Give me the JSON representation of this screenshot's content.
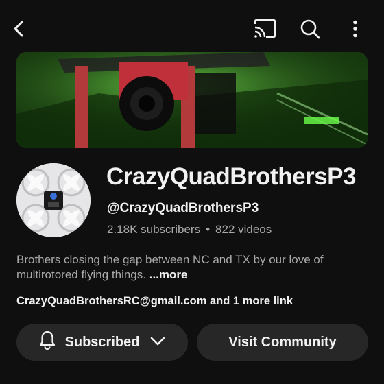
{
  "channel": {
    "name": "CrazyQuadBrothersP3",
    "handle": "@CrazyQuadBrothersP3",
    "subscribers": "2.18K subscribers",
    "separator": "•",
    "videos": "822 videos"
  },
  "description": {
    "text": "Brothers closing the gap between NC and TX by our love of multirotored flying things.",
    "more_label": "...more"
  },
  "links": {
    "text": "CrazyQuadBrothersRC@gmail.com and 1 more link"
  },
  "actions": {
    "subscribe_label": "Subscribed",
    "community_label": "Visit Community"
  },
  "icons": {
    "back": "back-arrow-icon",
    "cast": "cast-icon",
    "search": "search-icon",
    "more": "more-vert-icon",
    "bell": "bell-icon",
    "chevron": "chevron-down-icon"
  },
  "colors": {
    "background": "#0f0f0f",
    "button_bg": "#272727",
    "secondary_text": "#aaaaaa"
  }
}
